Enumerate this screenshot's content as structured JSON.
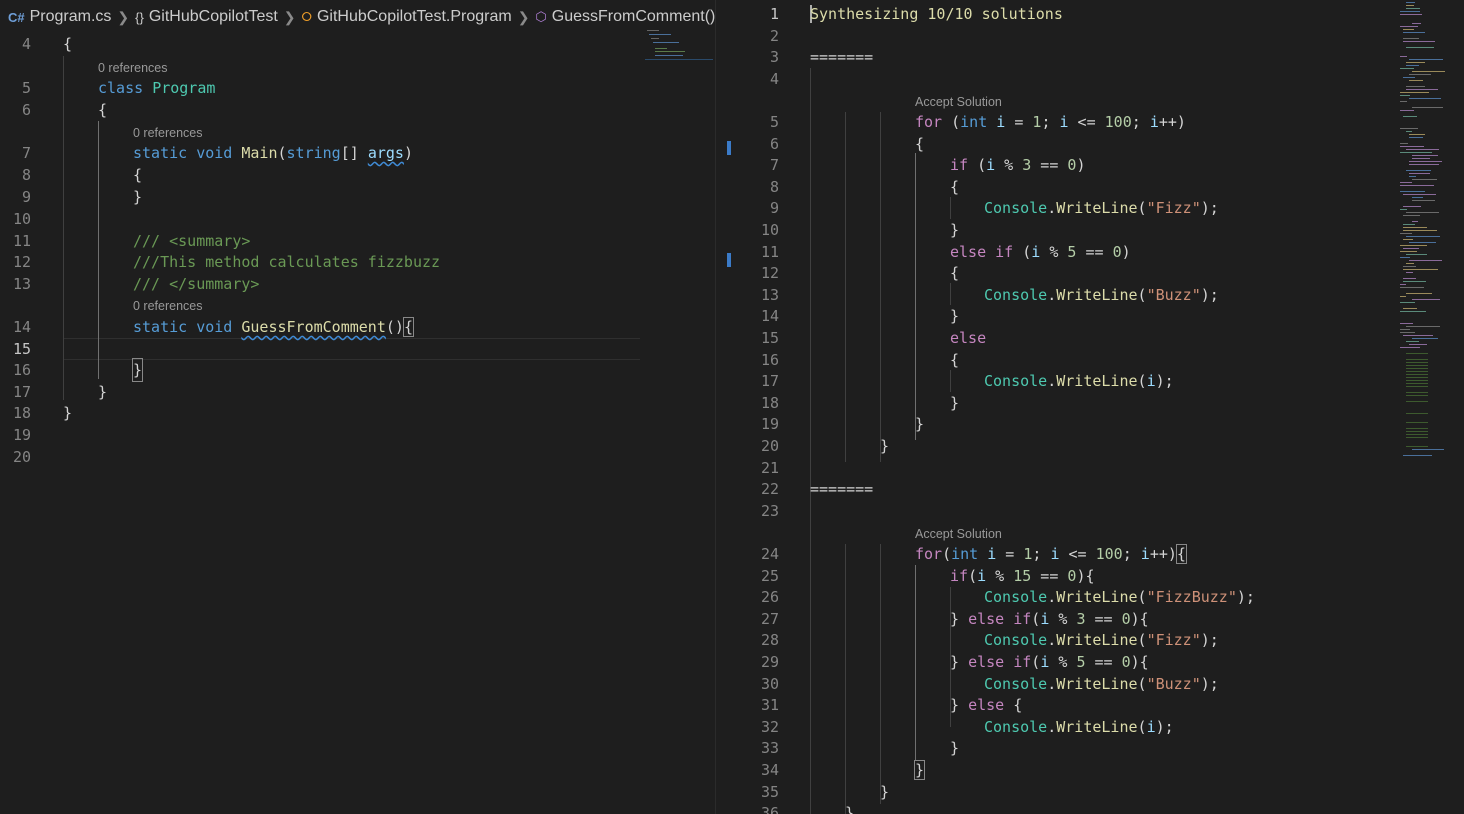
{
  "breadcrumb": {
    "file": "Program.cs",
    "namespace": "GitHubCopilotTest",
    "class": "GitHubCopilotTest.Program",
    "method": "GuessFromComment()",
    "icons": [
      "csharp-icon",
      "braces-icon",
      "class-icon",
      "method-icon"
    ],
    "csharp_glyph": "C#",
    "namespace_glyph": "{}"
  },
  "left_editor": {
    "line_numbers": [
      "4",
      "5",
      "6",
      "7",
      "8",
      "9",
      "10",
      "11",
      "12",
      "13",
      "14",
      "15",
      "16",
      "17",
      "18",
      "19",
      "20"
    ],
    "code_lens": [
      "0 references",
      "0 references",
      "0 references"
    ],
    "lines": {
      "l4": "{",
      "l5_kw": "class",
      "l5_name": "Program",
      "l6": "{",
      "l7_kw1": "static",
      "l7_kw2": "void",
      "l7_fn": "Main",
      "l7_type": "string",
      "l7_rest": "[]",
      "l7_param": "args",
      "l8": "{",
      "l9": "}",
      "l11": "/// <summary>",
      "l12": "///This method calculates fizzbuzz",
      "l13": "/// </summary>",
      "l14_kw1": "static",
      "l14_kw2": "void",
      "l14_fn": "GuessFromComment",
      "l16": "}",
      "l17": "}",
      "l18": "}"
    }
  },
  "right_editor": {
    "accept_label_1": "Accept Solution",
    "accept_label_2": "Accept Solution",
    "line_numbers": [
      "1",
      "2",
      "3",
      "4",
      "5",
      "6",
      "7",
      "8",
      "9",
      "10",
      "11",
      "12",
      "13",
      "14",
      "15",
      "16",
      "17",
      "18",
      "19",
      "20",
      "21",
      "22",
      "23",
      "24",
      "25",
      "26",
      "27",
      "28",
      "29",
      "30",
      "31",
      "32",
      "33",
      "34",
      "35",
      "36"
    ],
    "l1": "Synthesizing 10/10 solutions",
    "l3": "=======",
    "l22": "=======",
    "strings": {
      "fizz": "\"Fizz\"",
      "buzz": "\"Buzz\"",
      "fizzbuzz": "\"FizzBuzz\""
    },
    "words": {
      "for": "for",
      "int": "int",
      "if": "if",
      "else": "else",
      "console": "Console",
      "writeline": "WriteLine",
      "i": "i"
    },
    "numbers": {
      "one": "1",
      "hundred": "100",
      "three": "3",
      "five": "5",
      "fifteen": "15",
      "zero": "0"
    }
  },
  "colors": {
    "background": "#1e1e1e",
    "keyword": "#569cd6",
    "control": "#c586c0",
    "type": "#4ec9b0",
    "function": "#dcdcaa",
    "string": "#ce9178",
    "number": "#b5cea8",
    "comment": "#6a9955"
  }
}
